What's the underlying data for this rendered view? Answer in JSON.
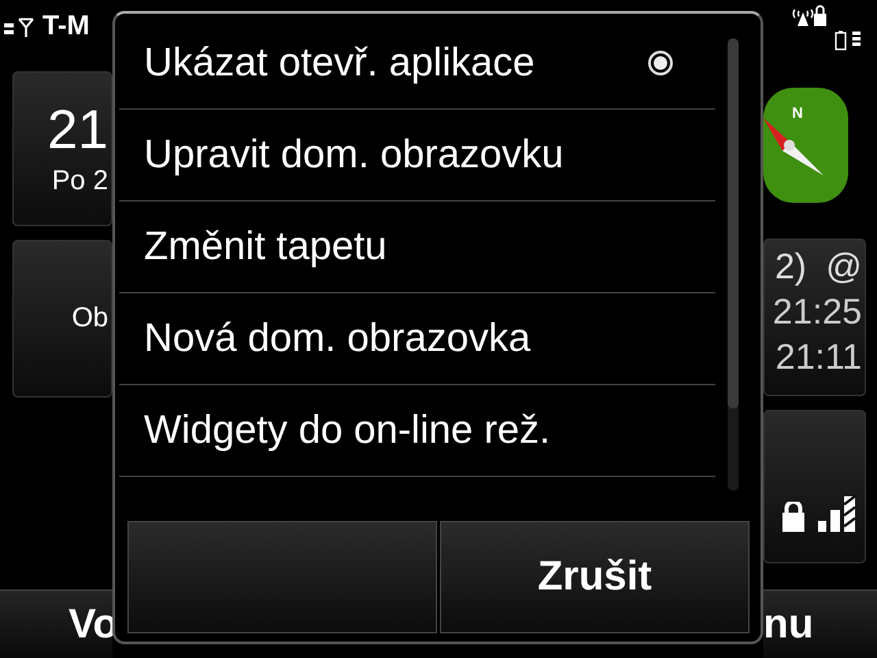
{
  "home": {
    "operator": "T-M",
    "clock": {
      "time": "21",
      "date": "Po 2"
    },
    "widget_text": "Ob",
    "compass_letter": "N",
    "mail": {
      "count": "2)",
      "at": "@",
      "times": [
        "21:25",
        "21:11"
      ]
    }
  },
  "softkeys": [
    "Vo",
    "nu"
  ],
  "menu": {
    "items": [
      {
        "label": "Ukázat otevř. aplikace",
        "kind": "radio",
        "checked": true
      },
      {
        "label": "Upravit dom. obrazovku",
        "kind": "plain"
      },
      {
        "label": "Změnit tapetu",
        "kind": "plain"
      },
      {
        "label": "Nová dom. obrazovka",
        "kind": "plain"
      },
      {
        "label": "Widgety do on-line rež.",
        "kind": "plain"
      }
    ],
    "buttons": [
      {
        "kind": "empty"
      },
      {
        "kind": "cancel",
        "label": "Zrušit"
      }
    ]
  }
}
